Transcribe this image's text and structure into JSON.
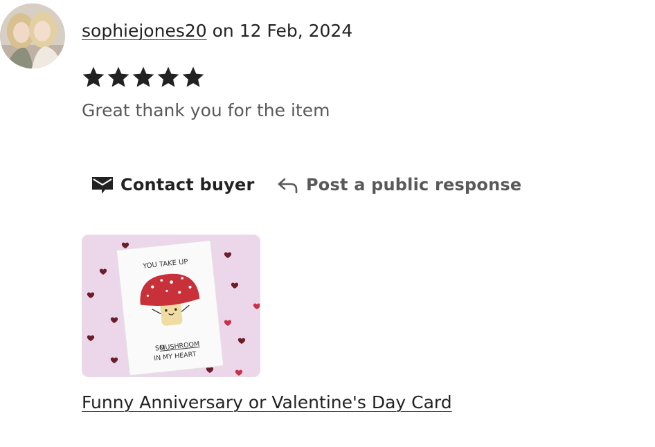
{
  "review": {
    "username": "sophiejones20",
    "date_text": " on 12 Feb, 2024",
    "rating": 5,
    "rating_max": 5,
    "text": "Great thank you for the item"
  },
  "actions": {
    "contact_label": "Contact buyer",
    "respond_label": "Post a public response"
  },
  "listing": {
    "title": "Funny Anniversary or Valentine's Day Card",
    "card_text_top": "YOU TAKE UP",
    "card_text_so": "SO ",
    "card_text_mushroom": "MUSHROOM",
    "card_text_bottom": "IN MY HEART"
  },
  "colors": {
    "text": "#222222",
    "muted": "#595959",
    "thumb_bg": "#ecd7ea",
    "mushroom_cap": "#c8303a"
  }
}
